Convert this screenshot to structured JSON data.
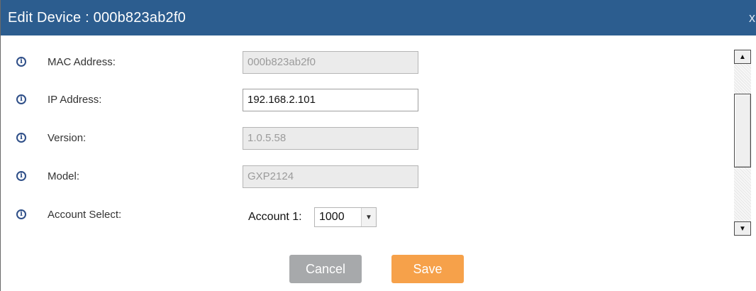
{
  "window": {
    "title": "Edit Device : 000b823ab2f0",
    "close_label": "x"
  },
  "fields": {
    "mac": {
      "label": "MAC Address:",
      "value": "000b823ab2f0",
      "disabled": true
    },
    "ip": {
      "label": "IP Address:",
      "value": "192.168.2.101",
      "disabled": false
    },
    "version": {
      "label": "Version:",
      "value": "1.0.5.58",
      "disabled": true
    },
    "model": {
      "label": "Model:",
      "value": "GXP2124",
      "disabled": true
    },
    "account_select": {
      "label": "Account Select:",
      "account_label": "Account 1:",
      "selected": "1000"
    }
  },
  "icons": {
    "info": "i",
    "dropdown_arrow": "▼",
    "scroll_up": "▲",
    "scroll_down": "▼"
  },
  "buttons": {
    "cancel": "Cancel",
    "save": "Save"
  },
  "colors": {
    "titlebar": "#2c5d8f",
    "save": "#f6a14a",
    "cancel": "#a7a9ab"
  }
}
